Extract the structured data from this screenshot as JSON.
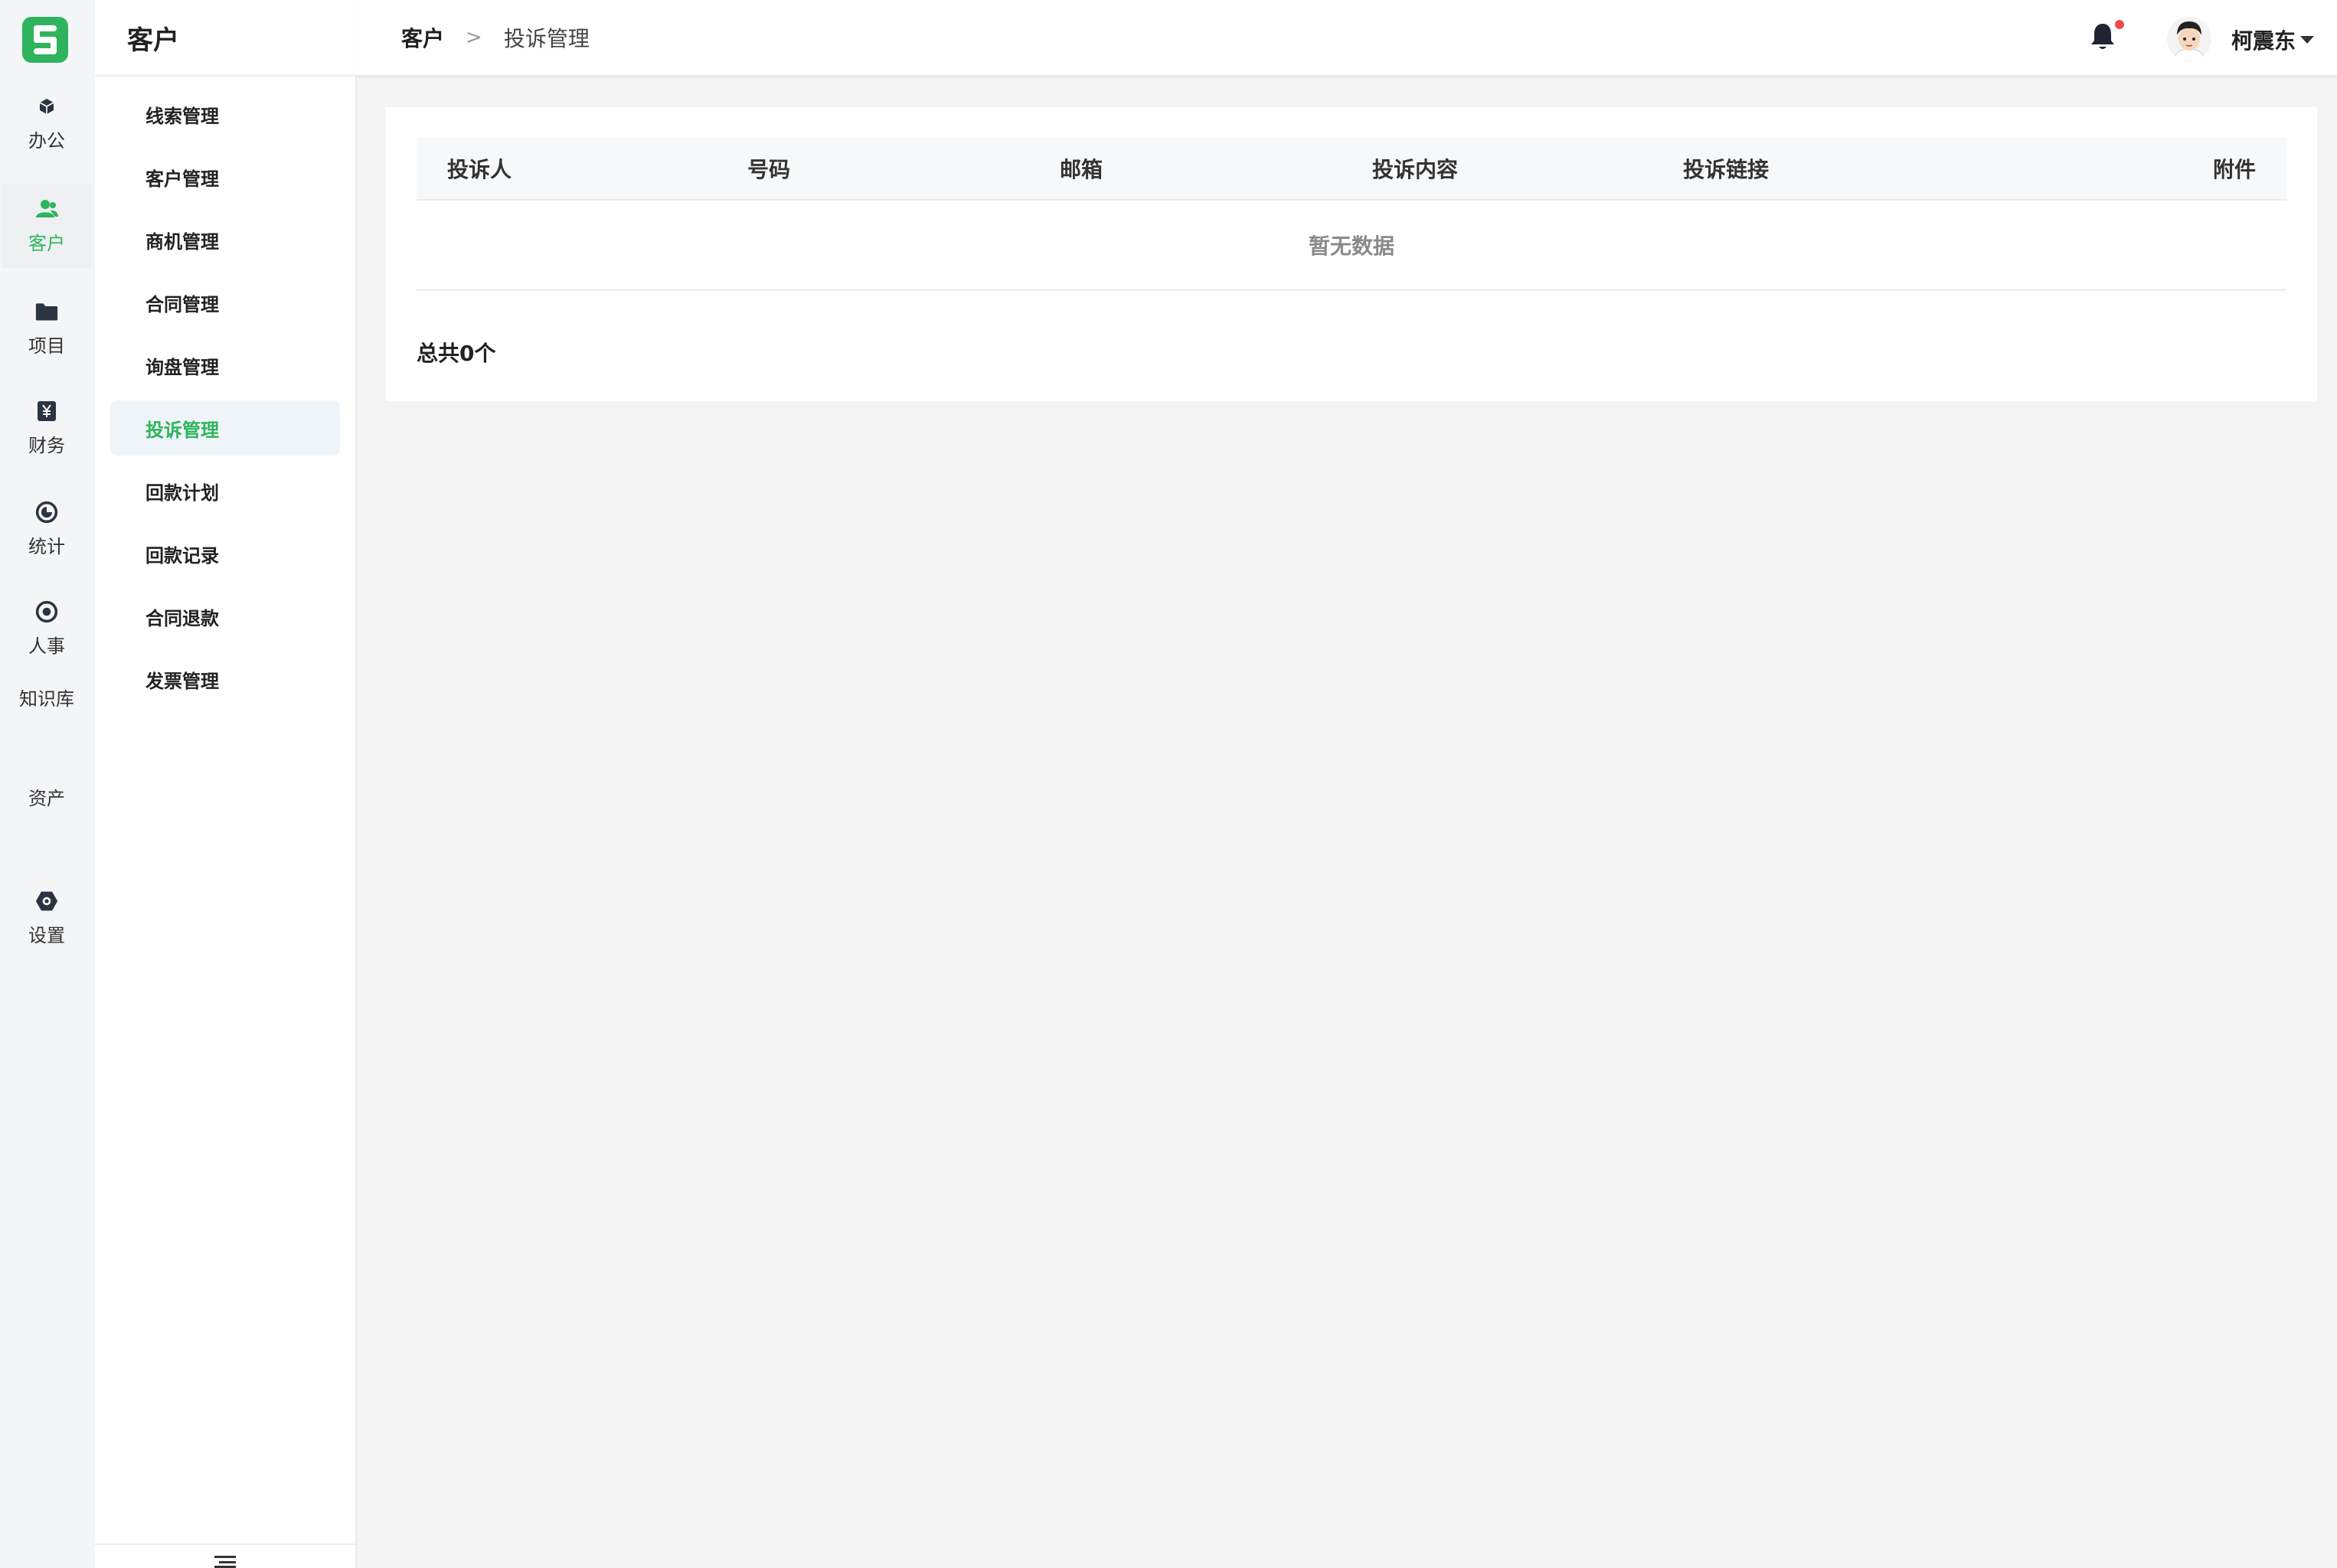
{
  "rail": {
    "items": [
      {
        "label": "办公",
        "icon": "cube-icon"
      },
      {
        "label": "客户",
        "icon": "users-icon",
        "active": true
      },
      {
        "label": "项目",
        "icon": "folder-icon"
      },
      {
        "label": "财务",
        "icon": "yen-icon"
      },
      {
        "label": "统计",
        "icon": "pie-chart-icon"
      },
      {
        "label": "人事",
        "icon": "target-icon"
      },
      {
        "label": "知识库"
      },
      {
        "label": "资产"
      },
      {
        "label": "设置",
        "icon": "settings-icon"
      }
    ]
  },
  "menu": {
    "title": "客户",
    "items": [
      {
        "label": "线索管理"
      },
      {
        "label": "客户管理"
      },
      {
        "label": "商机管理"
      },
      {
        "label": "合同管理"
      },
      {
        "label": "询盘管理"
      },
      {
        "label": "投诉管理",
        "active": true
      },
      {
        "label": "回款计划"
      },
      {
        "label": "回款记录"
      },
      {
        "label": "合同退款"
      },
      {
        "label": "发票管理"
      }
    ]
  },
  "header": {
    "breadcrumb": {
      "root": "客户",
      "separator": ">",
      "current": "投诉管理"
    },
    "user_name": "柯震东"
  },
  "table": {
    "columns": [
      "投诉人",
      "号码",
      "邮箱",
      "投诉内容",
      "投诉链接",
      "附件"
    ],
    "empty_text": "暂无数据",
    "total_text": "总共0个"
  },
  "colors": {
    "accent": "#2fb45e",
    "notification_dot": "#f04a4a"
  }
}
